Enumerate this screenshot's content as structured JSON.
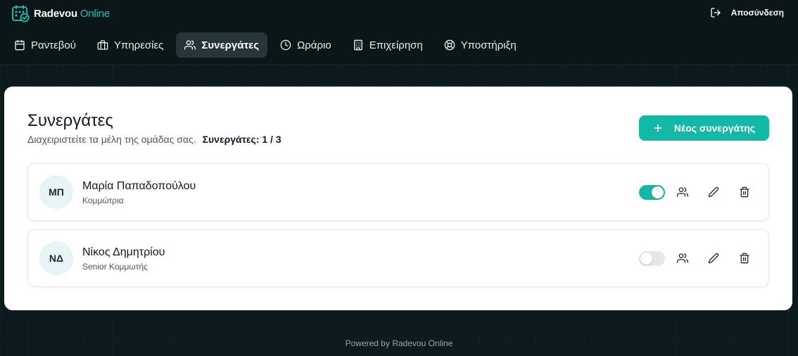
{
  "app": {
    "brand_name": "Radevou",
    "brand_suffix": "Online",
    "brand_icon": "calendar-check-icon",
    "logout_label": "Αποσύνδεση",
    "logout_icon": "logout-icon"
  },
  "nav": {
    "items": [
      {
        "label": "Ραντεβού",
        "icon": "calendar-icon",
        "active": false
      },
      {
        "label": "Υπηρεσίες",
        "icon": "briefcase-icon",
        "active": false
      },
      {
        "label": "Συνεργάτες",
        "icon": "users-icon",
        "active": true
      },
      {
        "label": "Ωράριο",
        "icon": "clock-icon",
        "active": false
      },
      {
        "label": "Επιχείρηση",
        "icon": "building-icon",
        "active": false
      },
      {
        "label": "Υποστήριξη",
        "icon": "lifebuoy-icon",
        "active": false
      }
    ]
  },
  "page": {
    "title": "Συνεργάτες",
    "subtitle": "Διαχειριστείτε τα μέλη της ομάδας σας.",
    "count_label": "Συνεργάτες:",
    "count_value": "1 / 3",
    "new_button_label": "Νέος συνεργάτης"
  },
  "members": [
    {
      "initials": "ΜΠ",
      "name": "Μαρία Παπαδοπούλου",
      "role": "Κομμώτρια",
      "active": true
    },
    {
      "initials": "ΝΔ",
      "name": "Νίκος Δημητρίου",
      "role": "Senior Κομμωτής",
      "active": false
    }
  ],
  "footer": {
    "text": "Powered by Radevou Online"
  },
  "colors": {
    "accent": "#14b8a6",
    "topbar": "#0b1619",
    "background": "#0d1a1d"
  }
}
